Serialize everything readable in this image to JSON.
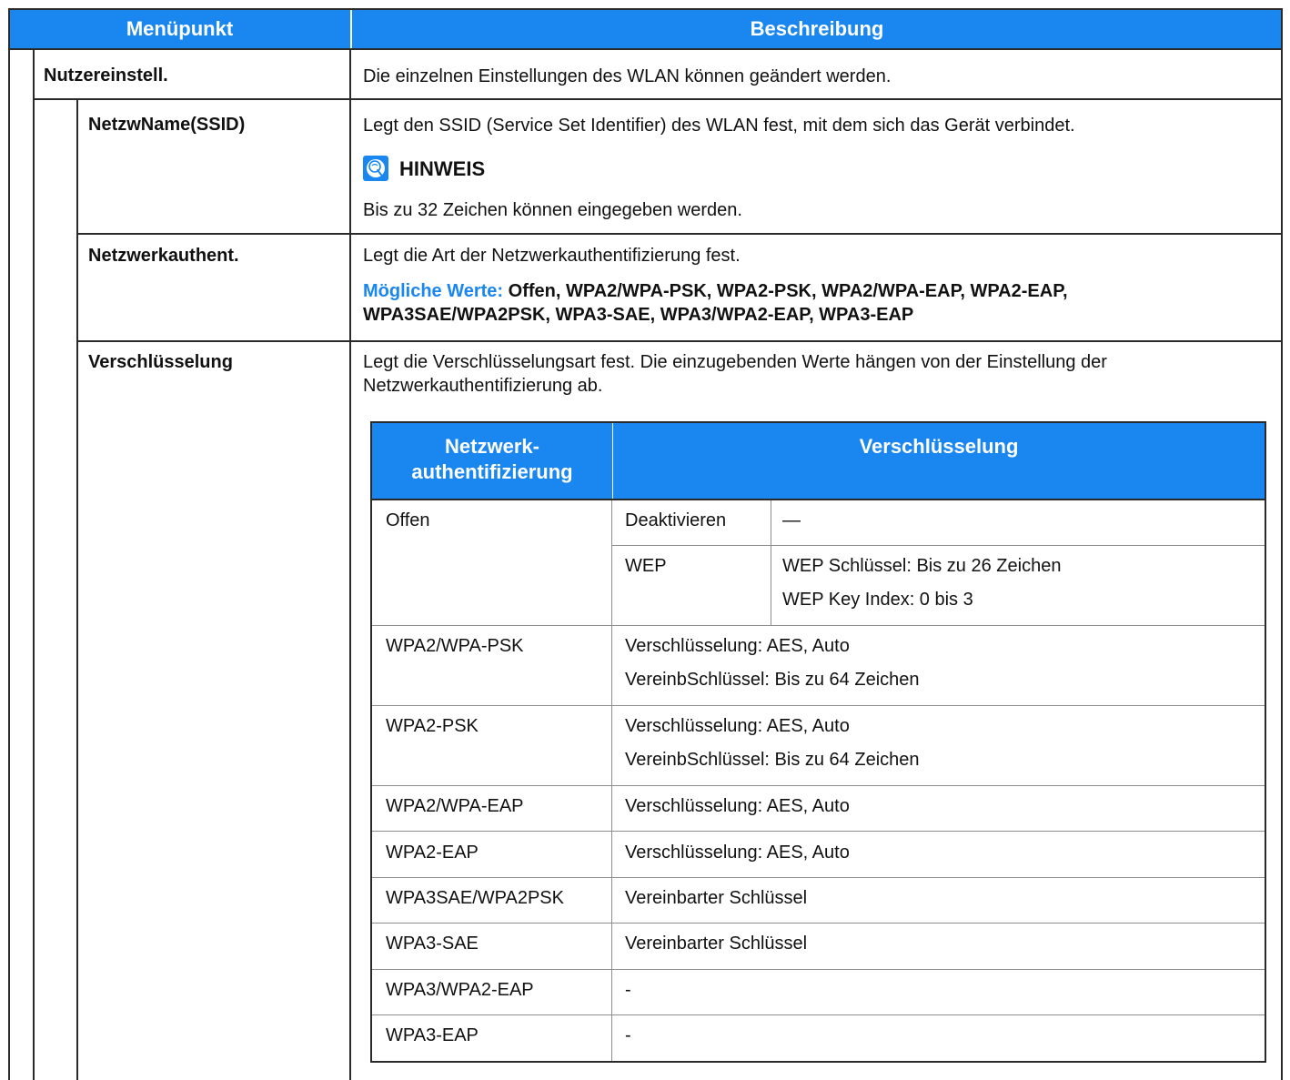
{
  "header": {
    "col_menu": "Menüpunkt",
    "col_desc": "Beschreibung"
  },
  "rows": {
    "nutzer": {
      "label": "Nutzereinstell.",
      "desc": "Die einzelnen Einstellungen des WLAN können geändert werden."
    },
    "ssid": {
      "label": "NetzwName(SSID)",
      "desc": "Legt den SSID (Service Set Identifier) des WLAN fest, mit dem sich das Gerät verbindet.",
      "note_title": "HINWEIS",
      "note_text": "Bis zu 32 Zeichen können eingegeben werden."
    },
    "auth": {
      "label": "Netzwerkauthent.",
      "desc": "Legt die Art der Netzwerkauthentifizierung fest.",
      "values_label": "Mögliche Werte:",
      "values_line1": " Offen, WPA2/WPA-PSK, WPA2-PSK, WPA2/WPA-EAP, WPA2-EAP,",
      "values_line2": "WPA3SAE/WPA2PSK, WPA3-SAE, WPA3/WPA2-EAP, WPA3-EAP"
    },
    "enc": {
      "label": "Verschlüsselung",
      "desc_line1": "Legt die Verschlüsselungsart fest. Die einzugebenden Werte hängen von der Einstellung der",
      "desc_line2": "Netzwerkauthentifizierung ab."
    }
  },
  "inner_table": {
    "header_auth_line1": "Netzwerk-",
    "header_auth_line2": "authentifizierung",
    "header_enc": "Verschlüsselung",
    "offen": {
      "label": "Offen",
      "deact": "Deaktivieren",
      "deact_value": "—",
      "wep": "WEP",
      "wep_line1": "WEP Schlüssel: Bis zu 26 Zeichen",
      "wep_line2": "WEP Key Index: 0 bis 3"
    },
    "rows": [
      {
        "auth": "WPA2/WPA-PSK",
        "line1": "Verschlüsselung: AES, Auto",
        "line2": "VereinbSchlüssel: Bis zu 64 Zeichen"
      },
      {
        "auth": "WPA2-PSK",
        "line1": "Verschlüsselung: AES, Auto",
        "line2": "VereinbSchlüssel: Bis zu 64 Zeichen"
      },
      {
        "auth": "WPA2/WPA-EAP",
        "line1": "Verschlüsselung: AES, Auto"
      },
      {
        "auth": "WPA2-EAP",
        "line1": "Verschlüsselung: AES, Auto"
      },
      {
        "auth": "WPA3SAE/WPA2PSK",
        "line1": "Vereinbarter Schlüssel"
      },
      {
        "auth": "WPA3-SAE",
        "line1": "Vereinbarter Schlüssel"
      },
      {
        "auth": "WPA3/WPA2-EAP",
        "line1": "-"
      },
      {
        "auth": "WPA3-EAP",
        "line1": "-"
      }
    ]
  },
  "icons": {
    "note": "hint-lightbulb-icon"
  },
  "colors": {
    "accent": "#1a86f0",
    "border": "#2a2a2a"
  }
}
